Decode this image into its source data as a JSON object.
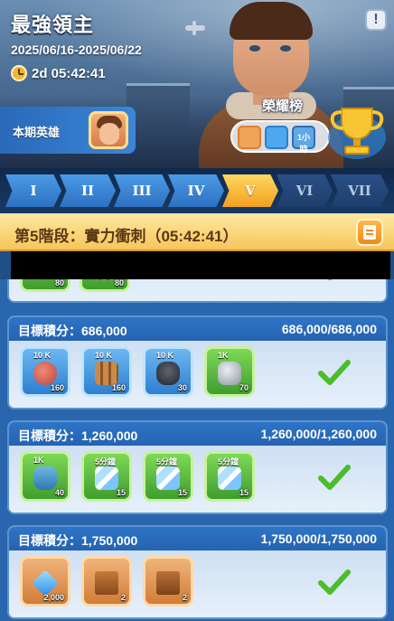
{
  "event": {
    "title": "最強領主",
    "date_range": "2025/06/16-2025/06/22",
    "timer": "2d 05:42:41",
    "period_hero_label": "本期英雄",
    "honor_label": "榮耀榜",
    "honor_speed_label": "1小時"
  },
  "stages": [
    "I",
    "II",
    "III",
    "IV",
    "V",
    "VI",
    "VII"
  ],
  "current_stage_index": 4,
  "phase": {
    "title": "第5階段：實力衝刺（05:42:41）"
  },
  "partial_goal": {
    "rewards": [
      {
        "icon": "meat-icon",
        "qty": "80"
      },
      {
        "icon": "wood-icon",
        "qty": "80"
      }
    ]
  },
  "goals": [
    {
      "target": "目標積分：686,000",
      "progress": "686,000/686,000",
      "completed": true,
      "rewards": [
        {
          "icon": "meat-icon",
          "tag": "10 K",
          "qty": "160",
          "style": "blue"
        },
        {
          "icon": "wood-icon",
          "tag": "10 K",
          "qty": "160",
          "style": "blue"
        },
        {
          "icon": "coal-icon",
          "tag": "10 K",
          "qty": "30",
          "style": "blue"
        },
        {
          "icon": "stone-icon",
          "tag": "1K",
          "qty": "70",
          "style": "green"
        }
      ]
    },
    {
      "target": "目標積分：1,260,000",
      "progress": "1,260,000/1,260,000",
      "completed": true,
      "rewards": [
        {
          "icon": "bottle-icon",
          "tag": "1K",
          "qty": "40",
          "style": "green"
        },
        {
          "icon": "speedup-icon",
          "tag": "5分鐘",
          "qty": "15",
          "style": "green"
        },
        {
          "icon": "speedup-icon",
          "tag": "5分鐘",
          "qty": "15",
          "style": "green"
        },
        {
          "icon": "speedup-icon",
          "tag": "5分鐘",
          "qty": "15",
          "style": "green"
        }
      ]
    },
    {
      "target": "目標積分：1,750,000",
      "progress": "1,750,000/1,750,000",
      "completed": true,
      "rewards": [
        {
          "icon": "gem-icon",
          "tag": "",
          "qty": "2,000",
          "style": "orange"
        },
        {
          "icon": "book-icon",
          "tag": "",
          "qty": "2",
          "style": "orange"
        },
        {
          "icon": "book-icon",
          "tag": "",
          "qty": "2",
          "style": "orange"
        }
      ]
    }
  ],
  "colors": {
    "current_stage": "#f6b33a",
    "done_stage": "#3d88d8",
    "locked_stage": "#234779",
    "check": "#4bbd2c"
  }
}
